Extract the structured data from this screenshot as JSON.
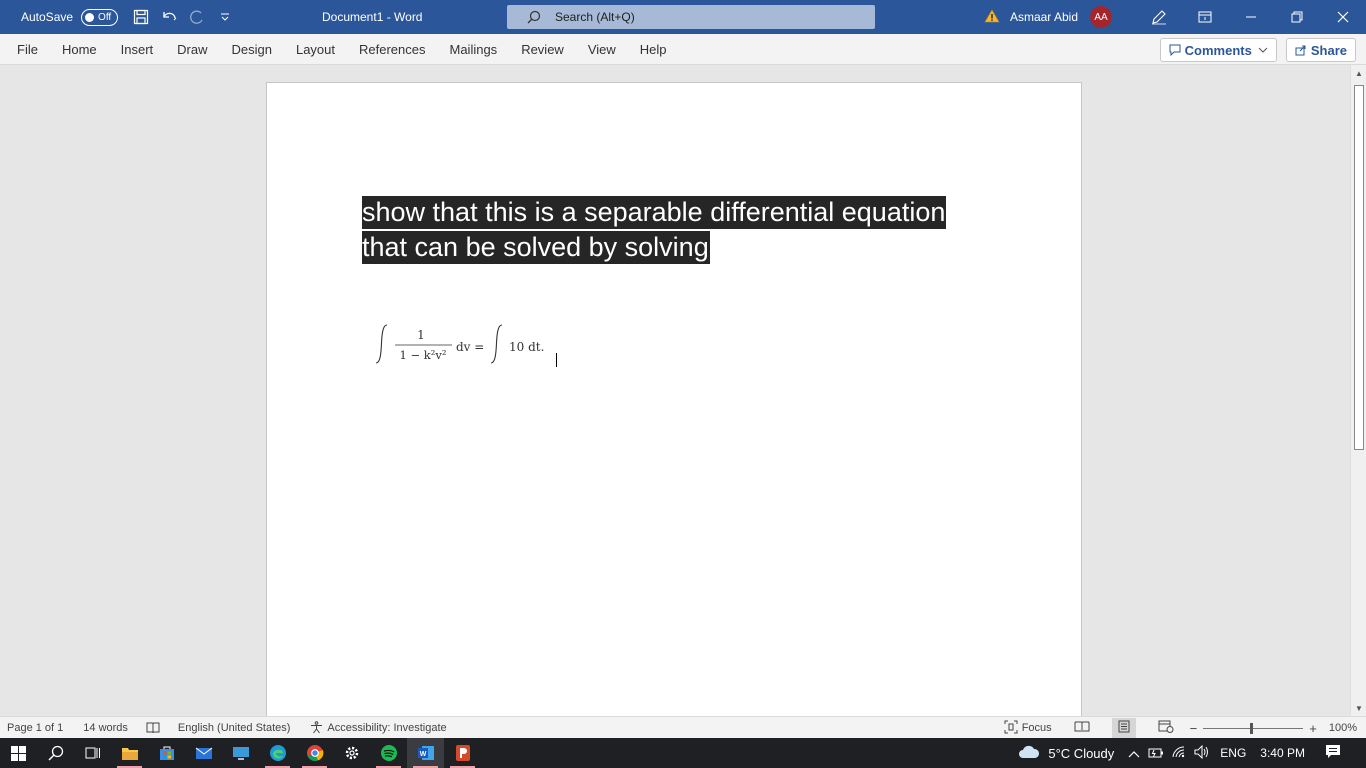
{
  "titlebar": {
    "autosave_label": "AutoSave",
    "autosave_state": "Off",
    "doc_title": "Document1  -  Word",
    "search_placeholder": "Search (Alt+Q)",
    "username": "Asmaar Abid",
    "avatar_initials": "AA"
  },
  "ribbon": {
    "tabs": [
      "File",
      "Home",
      "Insert",
      "Draw",
      "Design",
      "Layout",
      "References",
      "Mailings",
      "Review",
      "View",
      "Help"
    ],
    "comments_label": "Comments",
    "share_label": "Share"
  },
  "document": {
    "line1": "show that this is a separable differential equation",
    "line2": "that can be solved by solving",
    "equation": {
      "numerator": "1",
      "denominator": "1 − k²v²",
      "left_diff": "dv =",
      "right": "10 dt."
    }
  },
  "statusbar": {
    "page": "Page 1 of 1",
    "words": "14 words",
    "language": "English (United States)",
    "accessibility": "Accessibility: Investigate",
    "focus": "Focus",
    "zoom": "100%"
  },
  "taskbar": {
    "weather": "5°C  Cloudy",
    "language": "ENG",
    "time": "3:40 PM"
  },
  "colors": {
    "word_blue": "#2b579a",
    "selection": "#262626",
    "avatar": "#a4262c"
  }
}
